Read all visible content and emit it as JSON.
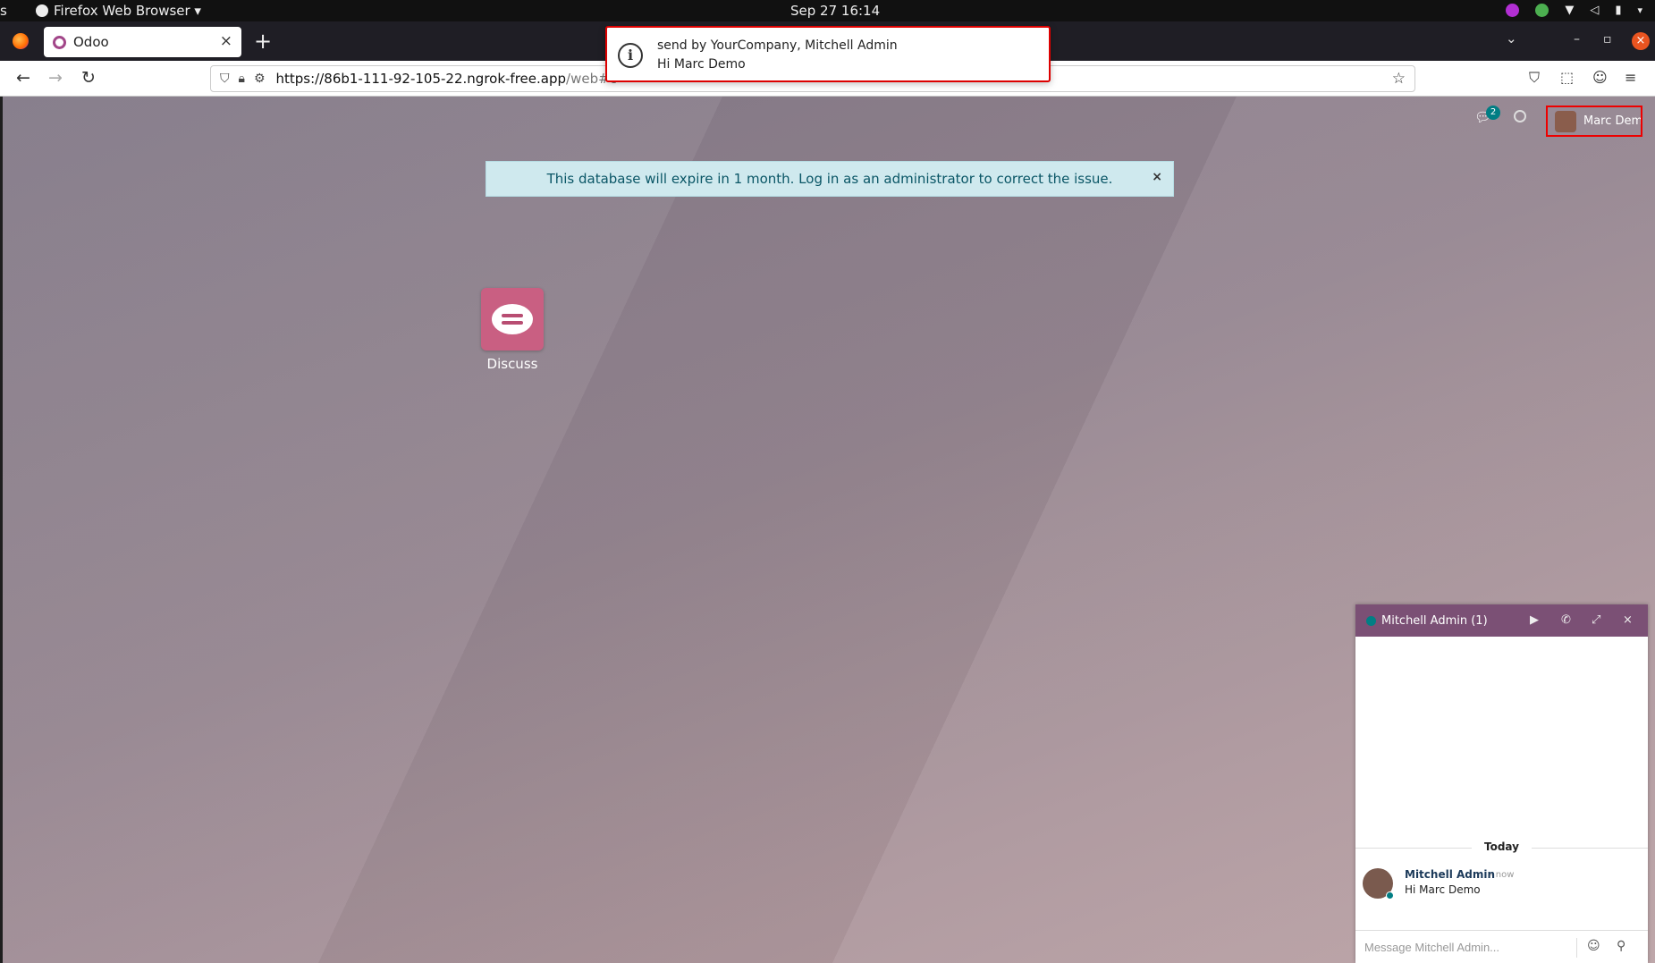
{
  "system": {
    "activities_label": "s",
    "app_menu_label": "Firefox Web Browser ▾",
    "clock": "Sep 27  16:14"
  },
  "browser": {
    "tab_title": "Odoo",
    "url_host": "https://86b1-111-92-105-22.ngrok-free.app",
    "url_path": "/web#c"
  },
  "notification": {
    "title": "send by YourCompany, Mitchell Admin",
    "body": "Hi Marc Demo"
  },
  "odoo": {
    "chat_unread_count": "2",
    "user_name": "Marc Demo",
    "expiry_banner": "This database will expire in 1 month. Log in as an administrator to correct the issue.",
    "apps": [
      {
        "label": "Discuss"
      }
    ]
  },
  "chat_window": {
    "title": "Mitchell Admin  (1)",
    "day_separator": "Today",
    "messages": [
      {
        "author": "Mitchell Admin",
        "time": "- now",
        "text": "Hi Marc Demo"
      }
    ],
    "composer_placeholder": "Message Mitchell Admin..."
  },
  "colors": {
    "odoo_brand": "#7b5075",
    "discuss_tile": "#c95f82",
    "teal_accent": "#017e84",
    "highlight_red": "#dd0000"
  }
}
